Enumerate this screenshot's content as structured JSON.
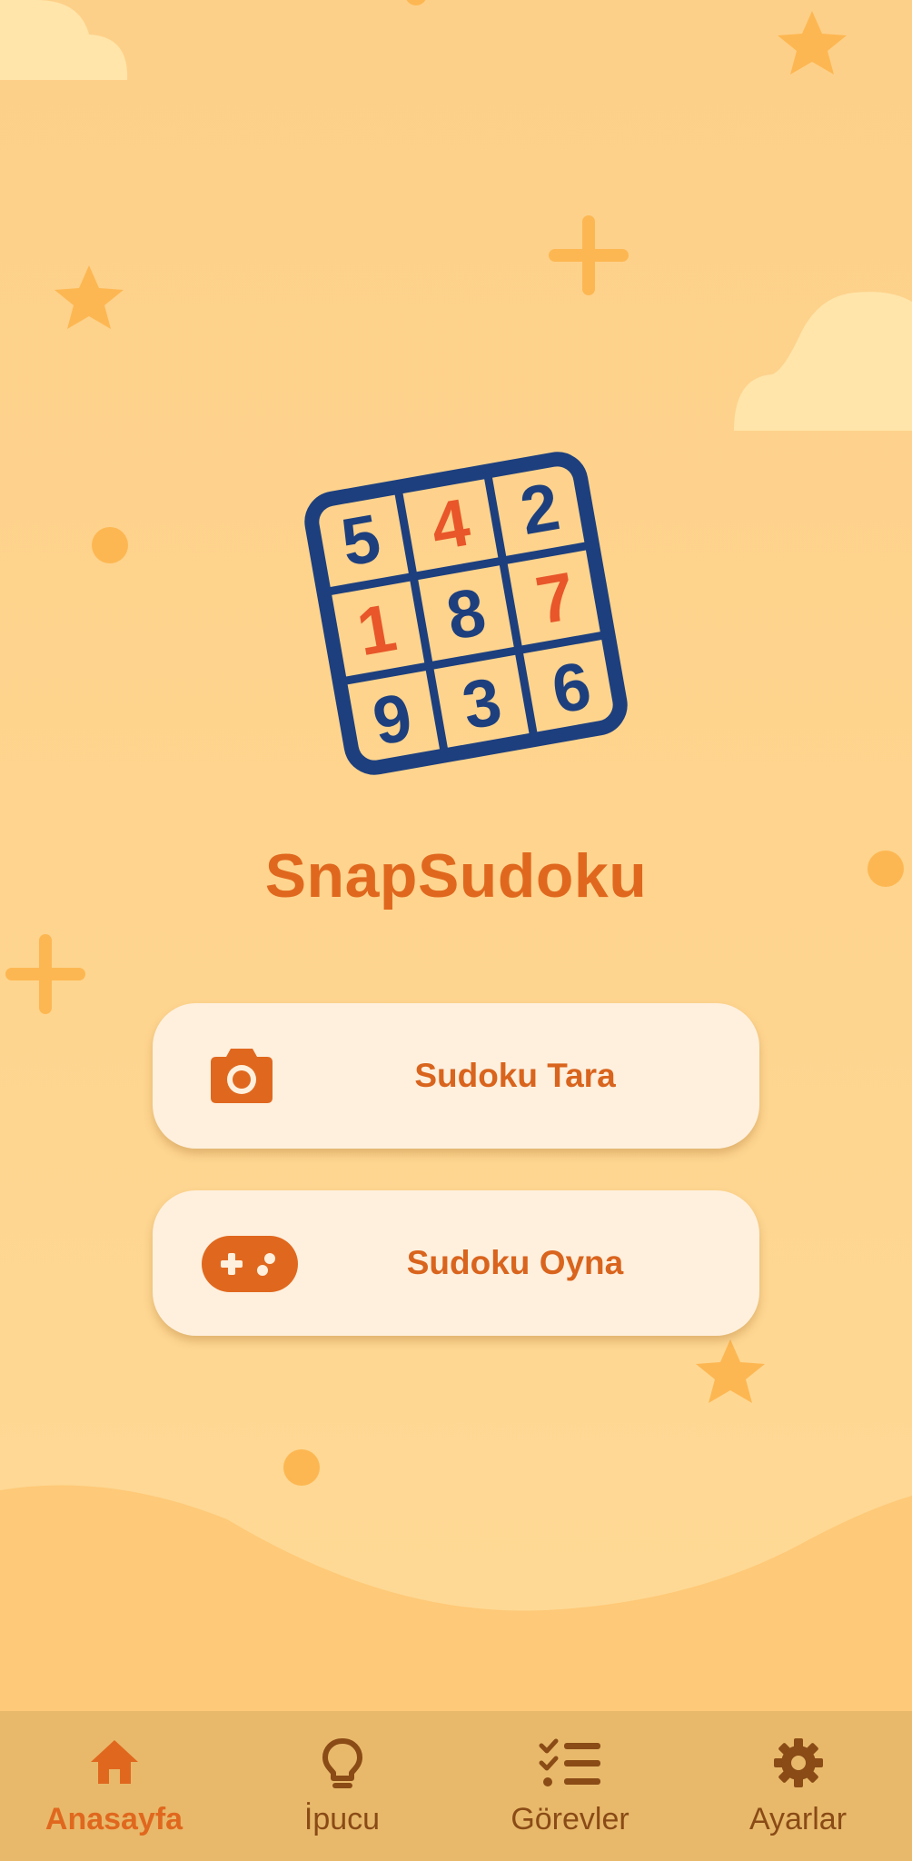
{
  "app": {
    "title": "SnapSudoku"
  },
  "logo": {
    "cells": [
      "5",
      "4",
      "2",
      "1",
      "8",
      "7",
      "9",
      "3",
      "6"
    ],
    "cell_colors": [
      "#1d3f7e",
      "#e8562a",
      "#1d3f7e",
      "#e8562a",
      "#1d3f7e",
      "#e8562a",
      "#1d3f7e",
      "#1d3f7e",
      "#1d3f7e"
    ]
  },
  "buttons": {
    "scan": {
      "label": "Sudoku Tara",
      "icon": "camera-icon"
    },
    "play": {
      "label": "Sudoku Oyna",
      "icon": "gamepad-icon"
    }
  },
  "nav": {
    "items": [
      {
        "label": "Anasayfa",
        "icon": "home-icon",
        "active": true
      },
      {
        "label": "İpucu",
        "icon": "lightbulb-icon",
        "active": false
      },
      {
        "label": "Görevler",
        "icon": "checklist-icon",
        "active": false
      },
      {
        "label": "Ayarlar",
        "icon": "gear-icon",
        "active": false
      }
    ]
  },
  "colors": {
    "accent": "#e0681e",
    "logo_navy": "#1d3f7e",
    "nav_bg": "#e8b96b",
    "button_bg": "#fff0de",
    "background": "#fdd089"
  }
}
